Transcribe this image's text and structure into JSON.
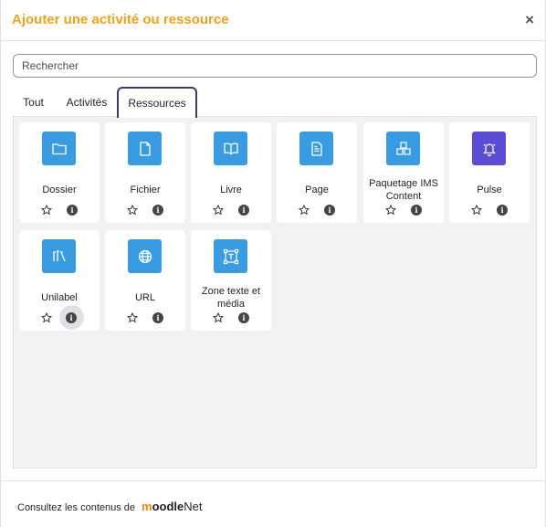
{
  "modal": {
    "title": "Ajouter une activité ou ressource",
    "close_symbol": "×"
  },
  "search": {
    "placeholder": "Rechercher",
    "value": ""
  },
  "tabs": [
    {
      "label": "Tout",
      "active": false
    },
    {
      "label": "Activités",
      "active": false
    },
    {
      "label": "Ressources",
      "active": true
    }
  ],
  "items": [
    {
      "label": "Dossier",
      "icon": "folder-icon",
      "color": "#399be2"
    },
    {
      "label": "Fichier",
      "icon": "file-icon",
      "color": "#399be2"
    },
    {
      "label": "Livre",
      "icon": "book-icon",
      "color": "#399be2"
    },
    {
      "label": "Page",
      "icon": "page-icon",
      "color": "#399be2"
    },
    {
      "label": "Paquetage IMS Content",
      "icon": "ims-package-icon",
      "color": "#399be2"
    },
    {
      "label": "Pulse",
      "icon": "bell-icon",
      "color": "#5b4cd5"
    },
    {
      "label": "Unilabel",
      "icon": "unilabel-icon",
      "color": "#399be2"
    },
    {
      "label": "URL",
      "icon": "globe-icon",
      "color": "#399be2"
    },
    {
      "label": "Zone texte et média",
      "icon": "text-media-icon",
      "color": "#399be2"
    }
  ],
  "footer": {
    "text": "Consultez les contenus de",
    "brand_m": "m",
    "brand_oodle": "oodle",
    "brand_net": "Net"
  }
}
